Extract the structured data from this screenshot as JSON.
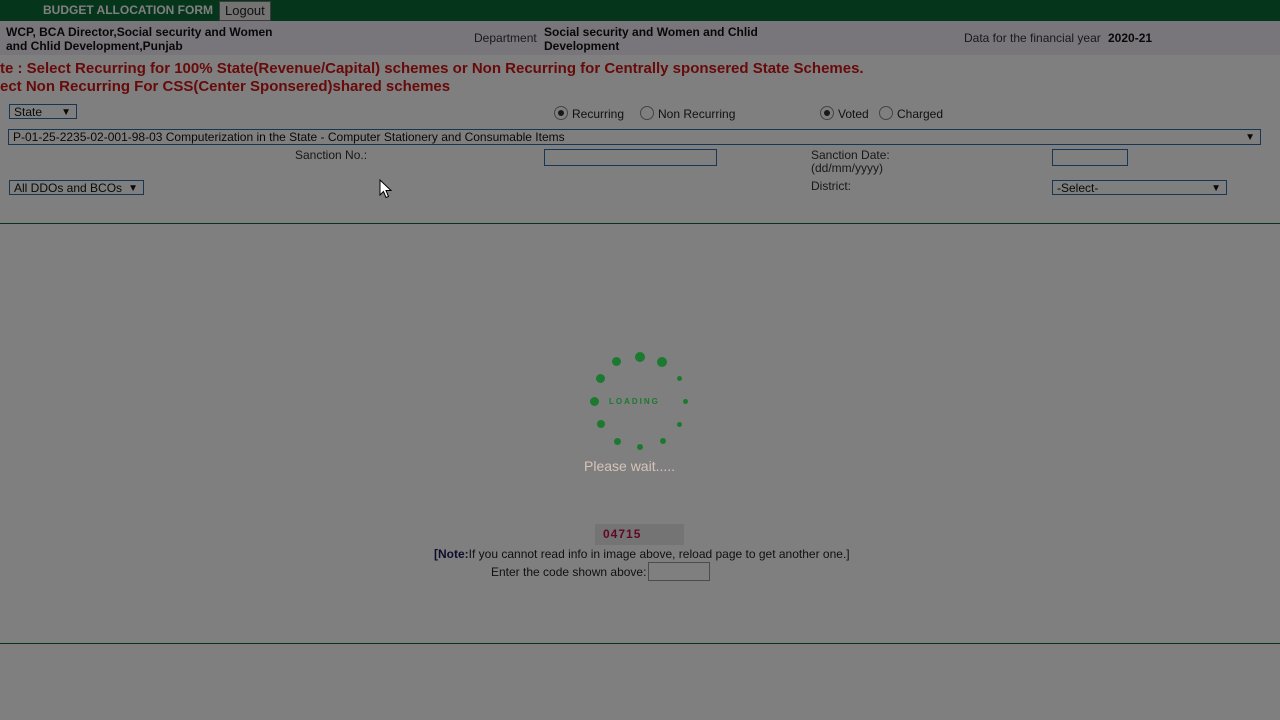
{
  "header": {
    "brand": "BUDGET ALLOCATION FORM",
    "logout_label": "Logout",
    "bg_color": "#0b6b37"
  },
  "info": {
    "user_line1": "WCP, BCA Director,Social security and Women",
    "user_line2": "and Chlid Development,Punjab",
    "department_label": "Department",
    "department_line1": "Social security and Women and Chlid",
    "department_line2": "Development",
    "fy_label": "Data for the financial year",
    "fy_value": "2020-21"
  },
  "notes": {
    "line1": "te : Select Recurring for 100% State(Revenue/Capital) schemes or Non Recurring for Centrally sponsered State Schemes.",
    "line2": "ect Non Recurring For CSS(Center Sponsered)shared schemes",
    "color": "#d01515"
  },
  "form": {
    "scheme_type_select": "State",
    "recurring_label": "Recurring",
    "non_recurring_label": "Non Recurring",
    "recurring_selected": "Recurring",
    "voted_label": "Voted",
    "charged_label": "Charged",
    "voted_selected": "Voted",
    "head_select": "P-01-25-2235-02-001-98-03 Computerization in the State - Computer Stationery and Consumable Items",
    "sanction_no_label": "Sanction No.:",
    "sanction_date_label_line1": "Sanction Date:",
    "sanction_date_label_line2": "(dd/mm/yyyy)",
    "ddo_select": "All DDOs and BCOs",
    "district_label": "District:",
    "district_select": "-Select-"
  },
  "loading": {
    "spinner_text": "LOADING",
    "wait_text": "Please wait.....",
    "accent": "#1b7a2f"
  },
  "captcha": {
    "code": "04715",
    "note_prefix": "[Note:",
    "note_text": "If you cannot read info in image above, reload page to get another one.]",
    "code_label": "Enter the code shown above:"
  },
  "icons": {
    "dropdown": "chevron-down-icon",
    "cursor": "mouse-pointer-icon",
    "spinner": "loading-spinner-icon"
  }
}
